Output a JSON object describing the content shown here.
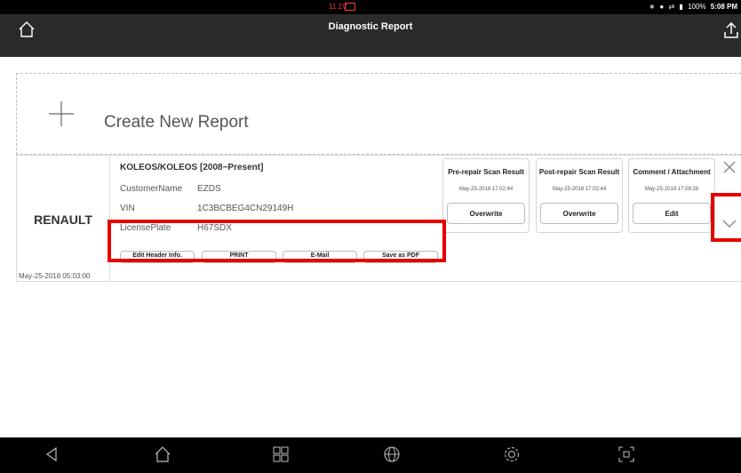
{
  "status_bar": {
    "voltage": "11.1V",
    "icons": [
      "bluetooth-icon",
      "do-not-disturb-icon",
      "network-icon",
      "battery-icon"
    ],
    "battery": "100%",
    "time": "5:08 PM"
  },
  "title_bar": {
    "title": "Diagnostic Report",
    "left_icon": "home-icon",
    "right_icon": "share-icon"
  },
  "create_report": {
    "label": "Create New Report",
    "icon": "plus-icon"
  },
  "report": {
    "make": "RENAULT",
    "date": "May-25-2018 05:03:00",
    "model": "KOLEOS/KOLEOS [2008~Present]",
    "fields": [
      {
        "label": "CustomerName",
        "value": "EZDS"
      },
      {
        "label": "VIN",
        "value": "1C3BCBEG4CN29149H"
      },
      {
        "label": "LicensePlate",
        "value": "H67SDX"
      }
    ],
    "actions": [
      {
        "label": "Edit Header Info."
      },
      {
        "label": "PRINT"
      },
      {
        "label": "E-Mail"
      },
      {
        "label": "Save as PDF"
      }
    ],
    "scans": [
      {
        "title": "Pre-repair Scan Result",
        "date": "May-25-2018 17:02:44",
        "button": "Overwrite"
      },
      {
        "title": "Post-repair Scan Result",
        "date": "May-25-2018 17:02:44",
        "button": "Overwrite"
      },
      {
        "title": "Comment / Attachment",
        "date": "May-25-2018 17:08:26",
        "button": "Edit"
      }
    ]
  },
  "colors": {
    "title_bar": "#2a2a2a",
    "highlight": "#e60000",
    "voltage": "#ff3b3b"
  },
  "nav_bar": {
    "icons": [
      "back-icon",
      "home-icon",
      "recent-apps-icon",
      "browser-icon",
      "settings-icon",
      "screenshot-icon"
    ]
  }
}
